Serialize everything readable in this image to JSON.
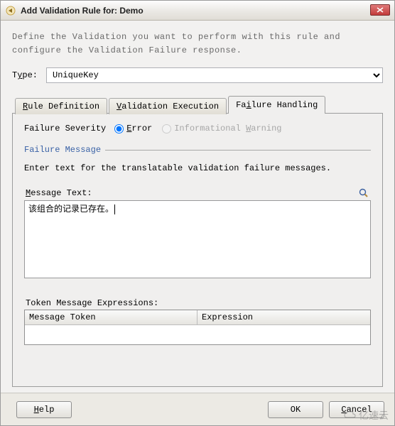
{
  "window": {
    "title": "Add Validation Rule for: Demo"
  },
  "description": "Define the Validation you want to perform with this rule and configure the Validation Failure response.",
  "type": {
    "label_pre": "T",
    "label_ul": "y",
    "label_post": "pe:",
    "value": "UniqueKey",
    "options": [
      "UniqueKey"
    ]
  },
  "tabs": [
    {
      "pre": "",
      "ul": "R",
      "post": "ule Definition",
      "active": false
    },
    {
      "pre": "",
      "ul": "V",
      "post": "alidation Execution",
      "active": false
    },
    {
      "pre": "Fa",
      "ul": "i",
      "post": "lure Handling",
      "active": true
    }
  ],
  "panel": {
    "severity_label": "Failure Severity",
    "radios": [
      {
        "ul": "E",
        "post": "rror",
        "checked": true,
        "disabled": false
      },
      {
        "pre": "Informational ",
        "ul": "W",
        "post": "arning",
        "checked": false,
        "disabled": true
      }
    ],
    "group_title": "Failure Message",
    "instruction": "Enter text for the translatable validation failure messages.",
    "msg_label_ul": "M",
    "msg_label_post": "essage Text:",
    "msg_value": "该组合的记录已存在。",
    "token_label": "Token Message Expressions:",
    "token_headers": {
      "col1": "Message Token",
      "col2": "Expression"
    },
    "token_rows": []
  },
  "footer": {
    "help_ul": "H",
    "help_post": "elp",
    "ok": "OK",
    "cancel_ul": "C",
    "cancel_post": "ancel"
  },
  "watermark": "亿速云"
}
